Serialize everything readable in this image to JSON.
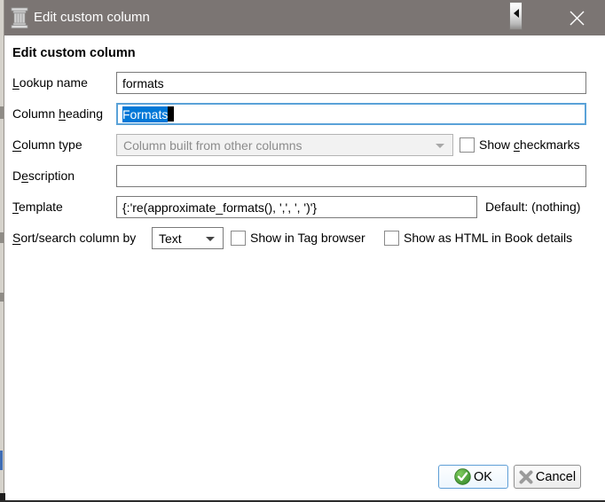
{
  "window": {
    "title": "Edit custom column"
  },
  "heading": "Edit custom column",
  "fields": {
    "lookup": {
      "label": {
        "pre": "",
        "key": "L",
        "post": "ookup name"
      },
      "value": "formats"
    },
    "heading": {
      "label": {
        "pre": "Column ",
        "key": "h",
        "post": "eading"
      },
      "value": "Formats",
      "selection": "all"
    },
    "type": {
      "label": {
        "pre": "",
        "key": "C",
        "post": "olumn type"
      },
      "value": "Column built from other columns",
      "disabled": true,
      "checkmarks_label": {
        "pre": "Show ",
        "key": "c",
        "post": "heckmarks"
      },
      "checkmarks_checked": false
    },
    "description": {
      "label": {
        "pre": "D",
        "key": "e",
        "post": "scription"
      },
      "value": ""
    },
    "template": {
      "label": {
        "pre": "",
        "key": "T",
        "post": "emplate"
      },
      "value": "{:'re(approximate_formats(), ',', ', ')'}",
      "default_note": "Default: (nothing)"
    },
    "sort": {
      "label": {
        "pre": "",
        "key": "S",
        "post": "ort/search column by"
      },
      "value": "Text",
      "tag_browser_label": "Show in Tag browser",
      "tag_browser_checked": false,
      "html_details_label": "Show as HTML in Book details",
      "html_details_checked": false
    }
  },
  "buttons": {
    "ok": "OK",
    "cancel": "Cancel"
  },
  "colors": {
    "titlebar": "#7b7573",
    "selection": "#0078d7",
    "focus_border": "#5aa2d8",
    "ok_icon_green": "#4aa043"
  }
}
